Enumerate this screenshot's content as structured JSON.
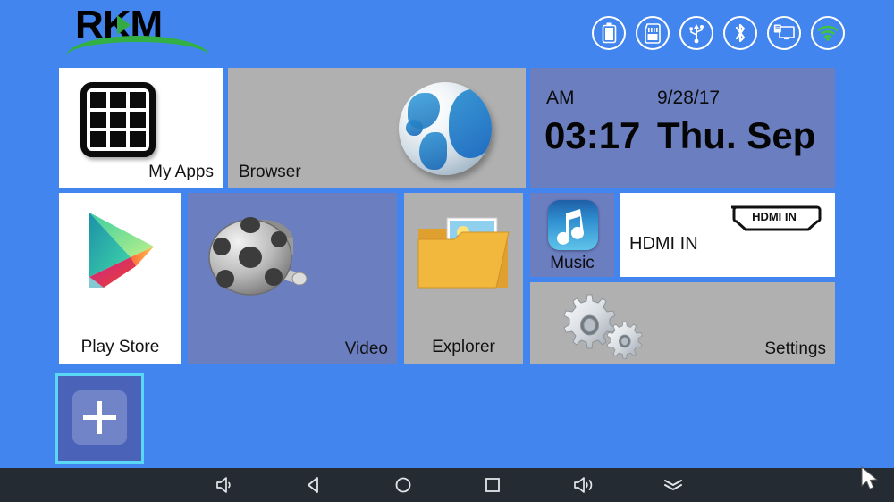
{
  "background_color": "#4285ef",
  "header": {
    "logo_text": "RKM",
    "logo_colors": {
      "text": "#000000",
      "accent": "#33b044"
    },
    "status_icons": [
      {
        "name": "battery-icon",
        "label": "Battery",
        "color": "#ffffff"
      },
      {
        "name": "sd-card-icon",
        "label": "SD Card",
        "color": "#ffffff"
      },
      {
        "name": "usb-icon",
        "label": "USB",
        "color": "#ffffff"
      },
      {
        "name": "bluetooth-icon",
        "label": "Bluetooth",
        "color": "#ffffff"
      },
      {
        "name": "ethernet-icon",
        "label": "Ethernet",
        "color": "#ffffff"
      },
      {
        "name": "wifi-icon",
        "label": "Wi-Fi",
        "color": "#3ec43e"
      }
    ]
  },
  "clock": {
    "meridiem": "AM",
    "date": "9/28/17",
    "time": "03:17",
    "day_month": "Thu. Sep",
    "background": "#6b7ec0"
  },
  "tiles": [
    {
      "id": "my-apps",
      "label": "My Apps",
      "icon": "apps-grid-icon",
      "background": "#ffffff",
      "label_pos": "bottom-right"
    },
    {
      "id": "browser",
      "label": "Browser",
      "icon": "globe-icon",
      "background": "#b0b0b0",
      "label_pos": "bottom-left"
    },
    {
      "id": "play-store",
      "label": "Play Store",
      "icon": "play-store-icon",
      "background": "#ffffff",
      "label_pos": "bottom-center"
    },
    {
      "id": "video",
      "label": "Video",
      "icon": "film-reel-icon",
      "background": "#6b7ec0",
      "label_pos": "bottom-right"
    },
    {
      "id": "explorer",
      "label": "Explorer",
      "icon": "folder-icon",
      "background": "#b0b0b0",
      "label_pos": "bottom-center"
    },
    {
      "id": "music",
      "label": "Music",
      "icon": "music-note-icon",
      "background": "#6b7ec0",
      "label_pos": "bottom-center"
    },
    {
      "id": "hdmi-in",
      "label": "HDMI IN",
      "icon": "hdmi-plug-icon",
      "background": "#ffffff",
      "label_pos": "left"
    },
    {
      "id": "settings",
      "label": "Settings",
      "icon": "gears-icon",
      "background": "#b0b0b0",
      "label_pos": "bottom-right"
    }
  ],
  "hdmi": {
    "plug_text": "HDMI IN",
    "tile_label": "HDMI IN"
  },
  "add_tile": {
    "icon": "plus-icon",
    "focused": true,
    "focus_color": "#5ad7f5"
  },
  "navbar": {
    "background": "#252b33",
    "buttons": [
      {
        "name": "volume-down-icon",
        "label": "Volume Down"
      },
      {
        "name": "back-icon",
        "label": "Back"
      },
      {
        "name": "home-icon",
        "label": "Home"
      },
      {
        "name": "recents-icon",
        "label": "Recent Apps"
      },
      {
        "name": "volume-up-icon",
        "label": "Volume Up"
      },
      {
        "name": "hide-navbar-icon",
        "label": "Hide Navigation Bar"
      }
    ]
  },
  "cursor": {
    "name": "mouse-cursor",
    "visible": true
  }
}
